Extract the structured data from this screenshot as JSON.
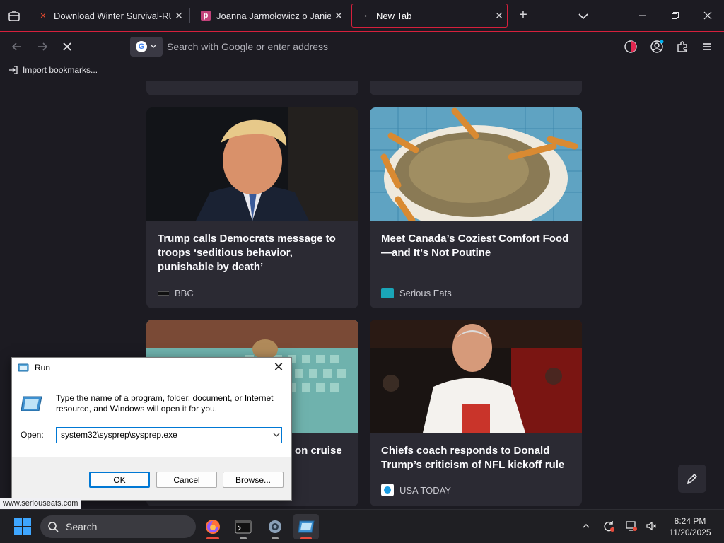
{
  "colors": {
    "accent": "#d6203c",
    "card_bg": "#2b2a33",
    "page_bg": "#1c1b22"
  },
  "tabs": [
    {
      "title": "Download Winter Survival-RUNE",
      "icon": "x-favicon-icon"
    },
    {
      "title": "Joanna Jarmołowicz o Janie Kró",
      "icon": "p-favicon-icon"
    },
    {
      "title": "New Tab",
      "icon": "firefox-favicon-icon"
    }
  ],
  "urlbar": {
    "placeholder": "Search with Google or enter address"
  },
  "bookmarks": {
    "import_label": "Import bookmarks..."
  },
  "cards": [
    {
      "headline": "Trump calls Democrats message to troops ‘seditious behavior, punishable by death’",
      "source": "BBC"
    },
    {
      "headline": "Meet Canada’s Coziest Comfort Food—and It’s Not Poutine",
      "source": "Serious Eats"
    },
    {
      "headline": "on cruise",
      "source": ""
    },
    {
      "headline": "Chiefs coach responds to Donald Trump’s criticism of NFL kickoff rule",
      "source": "USA TODAY"
    }
  ],
  "status_url": "www.seriouseats.com",
  "run_dialog": {
    "title": "Run",
    "description": "Type the name of a program, folder, document, or Internet resource, and Windows will open it for you.",
    "open_label": "Open:",
    "open_value": "system32\\sysprep\\sysprep.exe",
    "ok_label": "OK",
    "cancel_label": "Cancel",
    "browse_label": "Browse..."
  },
  "taskbar": {
    "search_label": "Search",
    "time": "8:24 PM",
    "date": "11/20/2025"
  }
}
